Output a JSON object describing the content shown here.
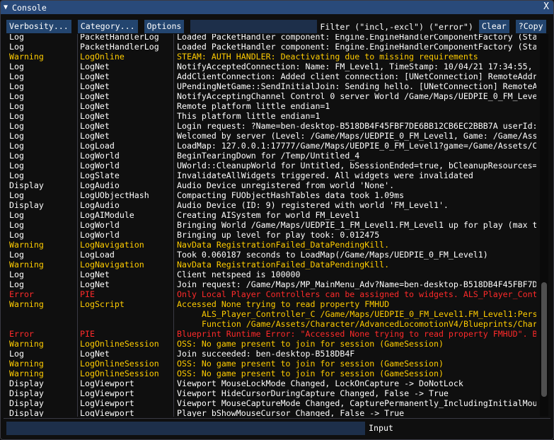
{
  "window": {
    "title": "Console",
    "collapse_icon": "triangle-down",
    "close_label": "X"
  },
  "toolbar": {
    "verbosity": "Verbosity...",
    "category": "Category...",
    "options": "Options",
    "filter_value": "",
    "filter_label": "Filter (\"incl,-excl\") (\"error\")",
    "clear": "Clear",
    "copy": "?Copy"
  },
  "colors": {
    "Log": "#ffffff",
    "Display": "#ffffff",
    "Warning": "#ffcc00",
    "Error": "#ff2a2a",
    "titlebar": "#294a7a",
    "button": "#23456f"
  },
  "scroll": {
    "position_fraction": 0.9,
    "visible_fraction": 0.3
  },
  "rows": [
    {
      "v": "Log",
      "c": "PacketHandlerLog",
      "m": "Loaded PacketHandler component: Engine.EngineHandlerComponentFactory (Sta"
    },
    {
      "v": "Log",
      "c": "PacketHandlerLog",
      "m": "Loaded PacketHandler component: Engine.EngineHandlerComponentFactory (Sta"
    },
    {
      "v": "Warning",
      "c": "LogOnline",
      "m": "STEAM: AUTH HANDLER: Deactivating due to missing requirements"
    },
    {
      "v": "Log",
      "c": "LogNet",
      "m": "NotifyAcceptedConnection: Name: FM_Level1, TimeStamp: 10/04/21 17:34:55,"
    },
    {
      "v": "Log",
      "c": "LogNet",
      "m": "AddClientConnection: Added client connection: [UNetConnection] RemoteAddr"
    },
    {
      "v": "Log",
      "c": "LogNet",
      "m": "UPendingNetGame::SendInitialJoin: Sending hello. [UNetConnection] RemoteA"
    },
    {
      "v": "Log",
      "c": "LogNet",
      "m": "NotifyAcceptingChannel Control 0 server World /Game/Maps/UEDPIE_0_FM_Leve"
    },
    {
      "v": "Log",
      "c": "LogNet",
      "m": "Remote platform little endian=1"
    },
    {
      "v": "Log",
      "c": "LogNet",
      "m": "This platform little endian=1"
    },
    {
      "v": "Log",
      "c": "LogNet",
      "m": "Login request: ?Name=ben-desktop-B518DB4F45FBF7DE6BB12CB6EC2BBB7A userId:"
    },
    {
      "v": "Log",
      "c": "LogNet",
      "m": "Welcomed by server (Level: /Game/Maps/UEDPIE_0_FM_Level1, Game: /Game/Ass"
    },
    {
      "v": "Log",
      "c": "LogLoad",
      "m": "LoadMap: 127.0.0.1:17777/Game/Maps/UEDPIE_0_FM_Level1?game=/Game/Assets/C"
    },
    {
      "v": "Log",
      "c": "LogWorld",
      "m": "BeginTearingDown for /Temp/Untitled_4"
    },
    {
      "v": "Log",
      "c": "LogWorld",
      "m": "UWorld::CleanupWorld for Untitled, bSessionEnded=true, bCleanupResources="
    },
    {
      "v": "Log",
      "c": "LogSlate",
      "m": "InvalidateAllWidgets triggered.  All widgets were invalidated"
    },
    {
      "v": "Display",
      "c": "LogAudio",
      "m": "Audio Device unregistered from world 'None'."
    },
    {
      "v": "Log",
      "c": "LogUObjectHash",
      "m": "Compacting FUObjectHashTables data took   1.09ms"
    },
    {
      "v": "Display",
      "c": "LogAudio",
      "m": "Audio Device (ID: 9) registered with world 'FM_Level1'."
    },
    {
      "v": "Log",
      "c": "LogAIModule",
      "m": "Creating AISystem for world FM_Level1"
    },
    {
      "v": "Log",
      "c": "LogWorld",
      "m": "Bringing World /Game/Maps/UEDPIE_1_FM_Level1.FM_Level1 up for play (max t"
    },
    {
      "v": "Log",
      "c": "LogWorld",
      "m": "Bringing up level for play took: 0.012475"
    },
    {
      "v": "Warning",
      "c": "LogNavigation",
      "m": "NavData RegistrationFailed_DataPendingKill."
    },
    {
      "v": "Log",
      "c": "LogLoad",
      "m": "Took 0.060187 seconds to LoadMap(/Game/Maps/UEDPIE_0_FM_Level1)"
    },
    {
      "v": "Warning",
      "c": "LogNavigation",
      "m": "NavData RegistrationFailed_DataPendingKill."
    },
    {
      "v": "Log",
      "c": "LogNet",
      "m": "Client netspeed is 100000"
    },
    {
      "v": "Log",
      "c": "LogNet",
      "m": "Join request: /Game/Maps/MP_MainMenu_Adv?Name=ben-desktop-B518DB4F45FBF7D"
    },
    {
      "v": "Error",
      "c": "PIE",
      "m": "Only Local Player Controllers can be assigned to widgets. ALS_Player_Cont"
    },
    {
      "v": "Warning",
      "c": "LogScript",
      "m": "Accessed None trying to read property FMHUD",
      "more": [
        "ALS_Player_Controller_C /Game/Maps/UEDPIE_0_FM_Level1.FM_Level1:Persi",
        "Function /Game/Assets/Character/AdvancedLocomotionV4/Blueprints/Chara"
      ]
    },
    {
      "v": "Error",
      "c": "PIE",
      "m": "Blueprint Runtime Error: \"Accessed None trying to read property FMHUD\". B"
    },
    {
      "v": "Warning",
      "c": "LogOnlineSession",
      "m": "OSS: No game present to join for session (GameSession)"
    },
    {
      "v": "Log",
      "c": "LogNet",
      "m": "Join succeeded: ben-desktop-B518DB4F"
    },
    {
      "v": "Warning",
      "c": "LogOnlineSession",
      "m": "OSS: No game present to join for session (GameSession)"
    },
    {
      "v": "Warning",
      "c": "LogOnlineSession",
      "m": "OSS: No game present to join for session (GameSession)"
    },
    {
      "v": "Display",
      "c": "LogViewport",
      "m": "Viewport MouseLockMode Changed, LockOnCapture -> DoNotLock"
    },
    {
      "v": "Display",
      "c": "LogViewport",
      "m": "Viewport HideCursorDuringCapture Changed, False -> True"
    },
    {
      "v": "Display",
      "c": "LogViewport",
      "m": "Viewport MouseCaptureMode Changed, CapturePermanently_IncludingInitialMou"
    },
    {
      "v": "Display",
      "c": "LogViewport",
      "m": "Player bShowMouseCursor Changed, False -> True"
    }
  ],
  "input": {
    "value": "",
    "label": "Input"
  }
}
